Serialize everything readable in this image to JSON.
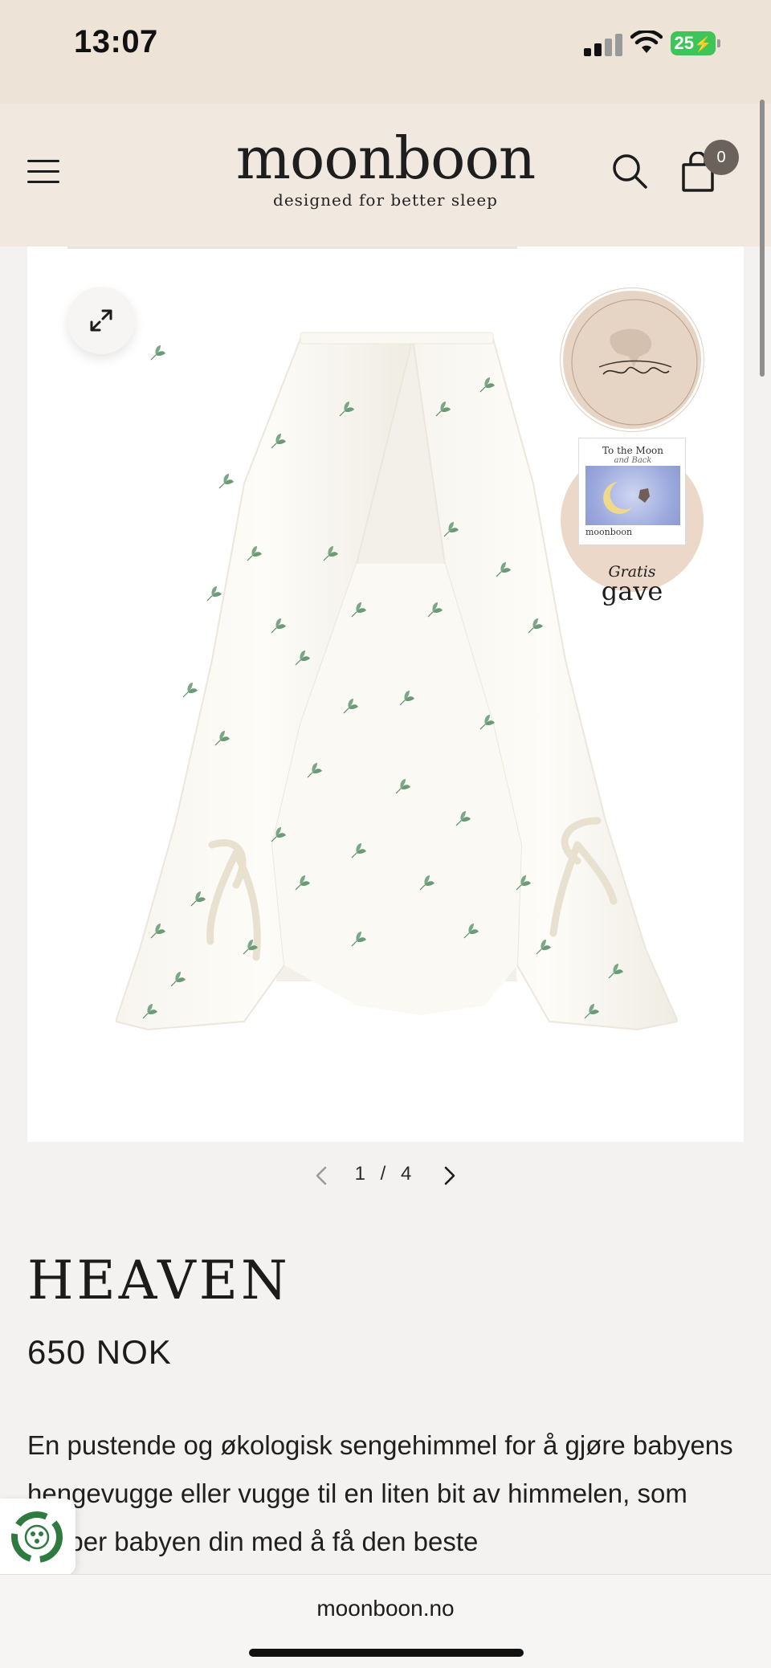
{
  "status_bar": {
    "time": "13:07",
    "battery_level": "25",
    "icons": [
      "cellular-signal-icon",
      "wifi-icon",
      "battery-charging-icon"
    ]
  },
  "header": {
    "logo_text": "moonboon",
    "tagline": "designed for better sleep",
    "cart_count": "0",
    "icons": [
      "menu-icon",
      "search-icon",
      "shopping-bag-icon"
    ]
  },
  "gallery": {
    "badges": {
      "gift_card_title": "To the Moon",
      "gift_card_subtitle": "and Back",
      "gift_card_brand": "moonboon",
      "gift_label_line1": "Gratis",
      "gift_label_line2": "gave"
    },
    "pager": {
      "current": 1,
      "total": 4,
      "text": "1 / 4"
    }
  },
  "product": {
    "title": "HEAVEN",
    "price": "650 NOK",
    "description": "En pustende og økologisk sengehimmel for å gjøre babyens hengevugge eller vugge til en liten bit av himmelen, som hjelper babyen din med å få den beste"
  },
  "browser": {
    "url": "moonboon.no"
  },
  "colors": {
    "status_bar_bg": "#eee3d7",
    "header_bg": "#f1e9df",
    "page_bg": "#f3f2f0",
    "battery_green": "#3dc55a",
    "leaf_green": "#6a9a78",
    "badge_bg": "#e6d4c4",
    "eco_green": "#2f7a3e"
  }
}
